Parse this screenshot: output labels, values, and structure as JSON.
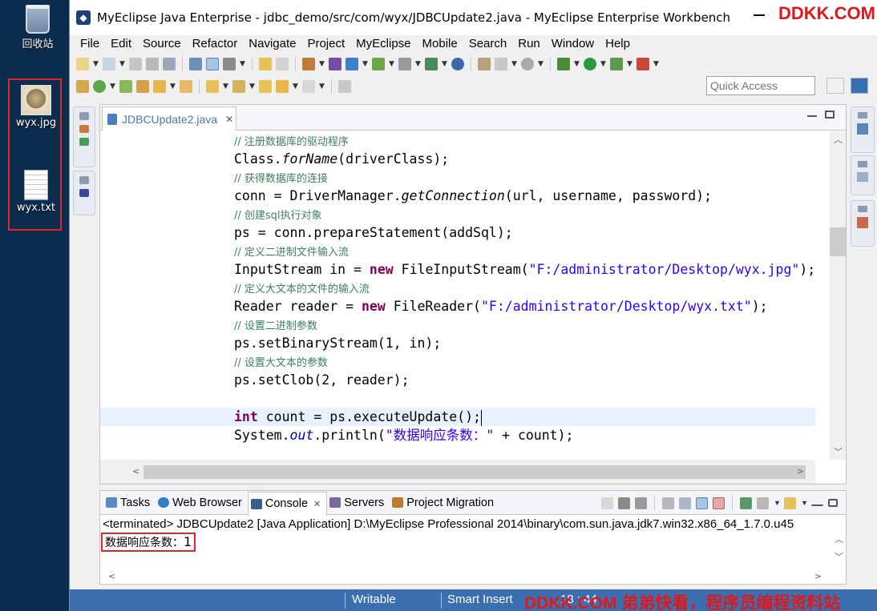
{
  "desktop": {
    "icons": [
      {
        "label": "回收站"
      },
      {
        "label": "wyx.jpg"
      },
      {
        "label": "wyx.txt"
      }
    ]
  },
  "window": {
    "title": "MyEclipse Java Enterprise - jdbc_demo/src/com/wyx/JDBCUpdate2.java - MyEclipse Enterprise Workbench",
    "watermark_top": "DDKK.COM"
  },
  "menu": [
    "File",
    "Edit",
    "Source",
    "Refactor",
    "Navigate",
    "Project",
    "MyEclipse",
    "Mobile",
    "Search",
    "Run",
    "Window",
    "Help"
  ],
  "quick_access": {
    "placeholder": "Quick Access"
  },
  "editor": {
    "tab_label": "JDBCUpdate2.java",
    "lines": [
      [
        {
          "t": "// 注册数据库的驱动程序",
          "c": "c"
        }
      ],
      [
        {
          "t": "Class."
        },
        {
          "t": "forName",
          "c": "i"
        },
        {
          "t": "(driverClass);"
        }
      ],
      [
        {
          "t": "// 获得数据库的连接",
          "c": "c"
        }
      ],
      [
        {
          "t": "conn = DriverManager."
        },
        {
          "t": "getConnection",
          "c": "i"
        },
        {
          "t": "(url, username, password);"
        }
      ],
      [
        {
          "t": "// 创建sql执行对象",
          "c": "c"
        }
      ],
      [
        {
          "t": "ps = conn.prepareStatement(addSql);"
        }
      ],
      [
        {
          "t": "// 定义二进制文件输入流",
          "c": "c"
        }
      ],
      [
        {
          "t": "InputStream in = "
        },
        {
          "t": "new",
          "c": "k"
        },
        {
          "t": " FileInputStream("
        },
        {
          "t": "\"F:/administrator/Desktop/wyx.jpg\"",
          "c": "s"
        },
        {
          "t": ");"
        }
      ],
      [
        {
          "t": "// 定义大文本的文件的输入流",
          "c": "c"
        }
      ],
      [
        {
          "t": "Reader reader = "
        },
        {
          "t": "new",
          "c": "k"
        },
        {
          "t": " FileReader("
        },
        {
          "t": "\"F:/administrator/Desktop/wyx.txt\"",
          "c": "s"
        },
        {
          "t": ");"
        }
      ],
      [
        {
          "t": "// 设置二进制参数",
          "c": "c"
        }
      ],
      [
        {
          "t": "ps.setBinaryStream(1, in);"
        }
      ],
      [
        {
          "t": "// 设置大文本的参数",
          "c": "c"
        }
      ],
      [
        {
          "t": "ps.setClob(2, reader);"
        }
      ],
      [],
      [
        {
          "t": "int",
          "c": "k"
        },
        {
          "t": " count = ps.executeUpdate();"
        },
        {
          "caret": true
        }
      ],
      [
        {
          "t": "System."
        },
        {
          "t": "out",
          "c": "o"
        },
        {
          "t": ".println("
        },
        {
          "t": "\"数据响应条数：\"",
          "c": "s"
        },
        {
          "t": " + count);"
        }
      ]
    ],
    "current_line_index": 15
  },
  "console": {
    "tabs": [
      {
        "label": "Tasks",
        "active": false,
        "icon": "tasks-icon",
        "color": "#5a8ac6"
      },
      {
        "label": "Web Browser",
        "active": false,
        "icon": "globe-icon",
        "color": "#2f7fc9"
      },
      {
        "label": "Console",
        "active": true,
        "icon": "console-icon",
        "color": "#3a5f8f"
      },
      {
        "label": "Servers",
        "active": false,
        "icon": "servers-icon",
        "color": "#7a6a9a"
      },
      {
        "label": "Project Migration",
        "active": false,
        "icon": "migration-icon",
        "color": "#c07a30"
      }
    ],
    "header": "<terminated> JDBCUpdate2 [Java Application] D:\\MyEclipse Professional 2014\\binary\\com.sun.java.jdk7.win32.x86_64_1.7.0.u45",
    "output_label": "数据响应条数：",
    "output_value": "1"
  },
  "status": {
    "writable": "Writable",
    "insert_mode": "Smart Insert",
    "position": "18 : 44",
    "watermark": "DDKK.COM 弟弟快看，程序员编程资料站"
  },
  "colors": {
    "keyword": "#7f0055",
    "string": "#2a00ff",
    "comment": "#3f7f5f",
    "statusbar": "#3c6fb0",
    "highlight_box": "#e0262a"
  }
}
